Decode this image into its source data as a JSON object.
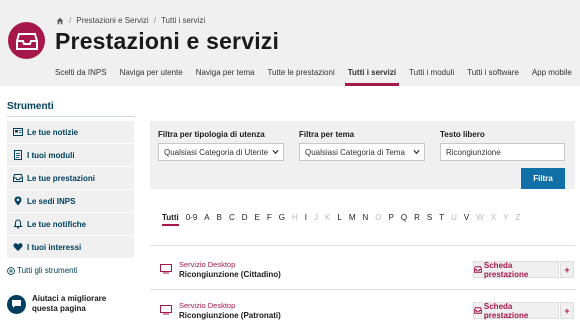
{
  "breadcrumb": {
    "home_icon": "home-icon",
    "items": [
      "Prestazioni e Servizi",
      "Tutti i servizi"
    ]
  },
  "page_title": "Prestazioni e servizi",
  "tabs": [
    {
      "label": "Scelti da INPS"
    },
    {
      "label": "Naviga per utente"
    },
    {
      "label": "Naviga per tema"
    },
    {
      "label": "Tutte le prestazioni"
    },
    {
      "label": "Tutti i servizi",
      "active": true
    },
    {
      "label": "Tutti i moduli"
    },
    {
      "label": "Tutti i software"
    },
    {
      "label": "App mobile"
    }
  ],
  "sidebar": {
    "title": "Strumenti",
    "items": [
      {
        "label": "Le tue notizie",
        "icon": "newspaper-icon"
      },
      {
        "label": "I tuoi moduli",
        "icon": "document-icon"
      },
      {
        "label": "Le tue prestazioni",
        "icon": "inbox-icon"
      },
      {
        "label": "Le sedi INPS",
        "icon": "map-pin-icon"
      },
      {
        "label": "Le tue notifiche",
        "icon": "bell-icon"
      },
      {
        "label": "I tuoi interessi",
        "icon": "heart-icon"
      }
    ],
    "all_tools": "Tutti gli strumenti",
    "help": "Aiutaci a migliorare questa pagina"
  },
  "filters": {
    "tipologia": {
      "label": "Filtra per tipologia di utenza",
      "value": "Qualsiasi Categoria di Utente"
    },
    "tema": {
      "label": "Filtra per tema",
      "value": "Qualsiasi Categoria di Tema"
    },
    "testo": {
      "label": "Testo libero",
      "value": "Ricongiunzione"
    },
    "button": "Filtra"
  },
  "alphabet": {
    "letters": [
      {
        "label": "Tutti",
        "active": true
      },
      {
        "label": "0-9"
      },
      {
        "label": "A"
      },
      {
        "label": "B"
      },
      {
        "label": "C"
      },
      {
        "label": "D"
      },
      {
        "label": "E"
      },
      {
        "label": "F"
      },
      {
        "label": "G"
      },
      {
        "label": "H",
        "disabled": true
      },
      {
        "label": "I"
      },
      {
        "label": "J",
        "disabled": true
      },
      {
        "label": "K",
        "disabled": true
      },
      {
        "label": "L"
      },
      {
        "label": "M"
      },
      {
        "label": "N"
      },
      {
        "label": "O",
        "disabled": true
      },
      {
        "label": "P"
      },
      {
        "label": "Q"
      },
      {
        "label": "R"
      },
      {
        "label": "S"
      },
      {
        "label": "T"
      },
      {
        "label": "U",
        "disabled": true
      },
      {
        "label": "V"
      },
      {
        "label": "W",
        "disabled": true
      },
      {
        "label": "X",
        "disabled": true
      },
      {
        "label": "Y",
        "disabled": true
      },
      {
        "label": "Z",
        "disabled": true
      }
    ]
  },
  "results": [
    {
      "type": "Servizio Desktop",
      "title": "Ricongiunzione (Cittadino)",
      "button": "Scheda prestazione",
      "plus": "+"
    },
    {
      "type": "Servizio Desktop",
      "title": "Ricongiunzione (Patronati)",
      "button": "Scheda prestazione",
      "plus": "+"
    }
  ],
  "colors": {
    "brand": "#a6174a",
    "primary": "#0f6fa6",
    "dark_blue": "#00405e"
  }
}
